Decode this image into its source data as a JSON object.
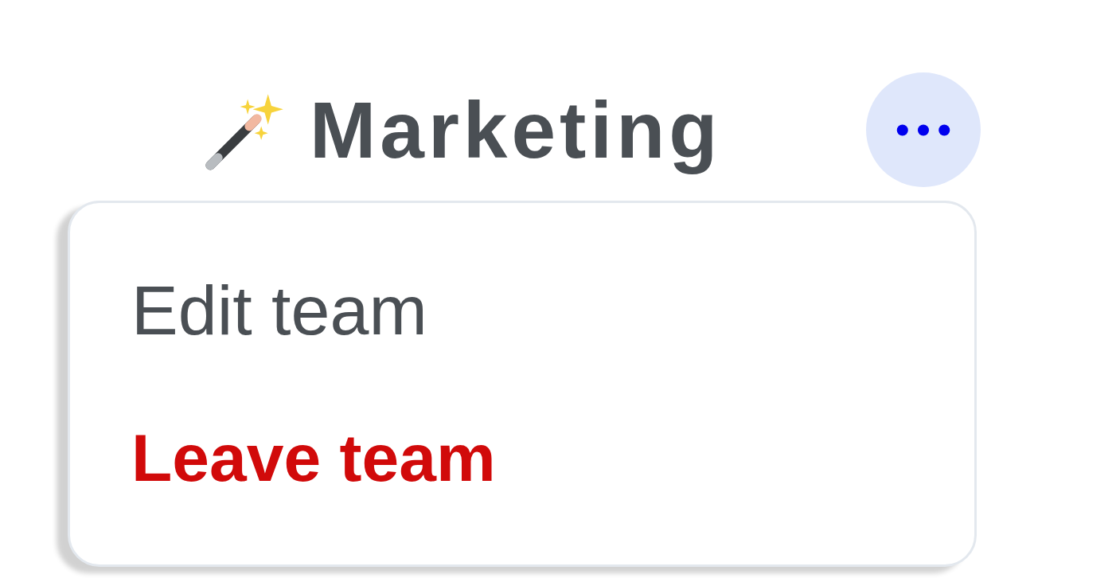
{
  "team": {
    "name": "Marketing"
  },
  "more_button": {
    "expanded": true
  },
  "menu": {
    "items": [
      {
        "label": "Edit team",
        "kind": "normal"
      },
      {
        "label": "Leave team",
        "kind": "danger"
      }
    ]
  }
}
